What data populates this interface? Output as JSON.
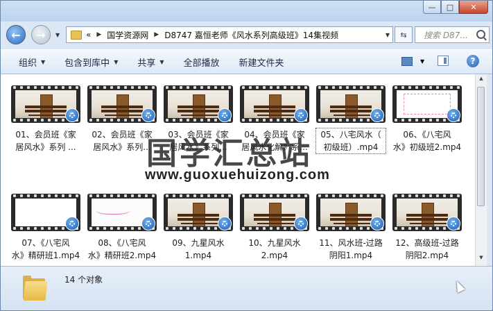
{
  "window": {
    "controls": {
      "minimize": "—",
      "maximize": "□",
      "close": "✕"
    }
  },
  "nav": {
    "back_icon": "arrow-left-icon",
    "forward_icon": "arrow-right-icon",
    "breadcrumb": {
      "prefix": "«",
      "items": [
        "国学资源网",
        "D8747 嘉恒老师《风水系列高级班》14集视频"
      ]
    },
    "search_placeholder": "搜索 D87..."
  },
  "toolbar": {
    "organize": "组织",
    "include_library": "包含到库中",
    "share": "共享",
    "play_all": "全部播放",
    "new_folder": "新建文件夹"
  },
  "files": [
    {
      "label": "01、会员班《家\n居风水》系列 ...",
      "thumb": "scene"
    },
    {
      "label": "02、会员班《家\n居风水》系列...",
      "thumb": "scene"
    },
    {
      "label": "03、会员班《家\n居风水》系列...",
      "thumb": "scene"
    },
    {
      "label": "04、会员班《家\n居风水化解》系...",
      "thumb": "scene"
    },
    {
      "label": "05、八宅风水（\n初级班）.mp4",
      "thumb": "scene"
    },
    {
      "label": "06、《八宅风\n水》初级班2.mp4",
      "thumb": "chart"
    },
    {
      "label": "07、《八宅风\n水》精研班1.mp4",
      "thumb": "white"
    },
    {
      "label": "08、《八宅风\n水》精研班2.mp4",
      "thumb": "hand"
    },
    {
      "label": "09、九星风水\n1.mp4",
      "thumb": "scene"
    },
    {
      "label": "10、九星风水\n2.mp4",
      "thumb": "scene"
    },
    {
      "label": "11、风水班-过路\n阴阳1.mp4",
      "thumb": "scene"
    },
    {
      "label": "12、高级班-过路\n阴阳2.mp4",
      "thumb": "scene"
    }
  ],
  "watermark": {
    "title": "国学汇总站",
    "url": "www.guoxuehuizong.com"
  },
  "status": {
    "item_count": "14 个对象"
  },
  "colors": {
    "accent": "#2a6fc0",
    "close": "#c7462b",
    "folder": "#e7b947"
  }
}
